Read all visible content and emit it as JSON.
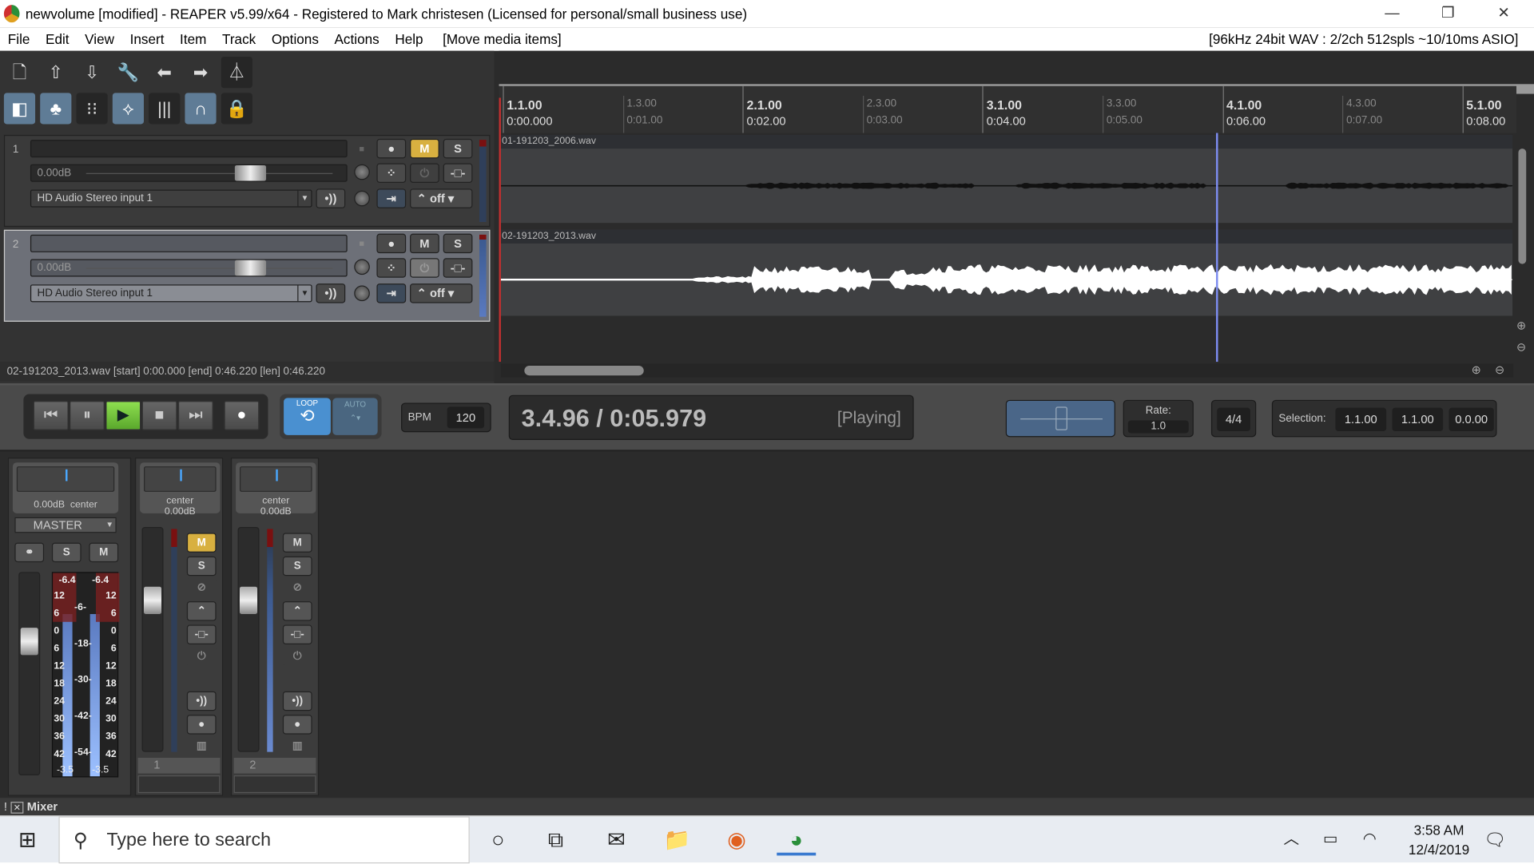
{
  "window": {
    "title": "newvolume [modified] - REAPER v5.99/x64 - Registered to Mark christesen (Licensed for personal/small business use)",
    "minimize": "—",
    "restore": "❐",
    "close": "✕"
  },
  "menu": {
    "items": [
      "File",
      "Edit",
      "View",
      "Insert",
      "Item",
      "Track",
      "Options",
      "Actions",
      "Help"
    ],
    "action": "[Move media items]",
    "audio_info": "[96kHz 24bit WAV : 2/2ch 512spls ~10/10ms ASIO]"
  },
  "tracks": [
    {
      "number": "1",
      "volume": "0.00dB",
      "input": "HD Audio Stereo input 1",
      "rec": "●",
      "mute": "M",
      "solo": "S",
      "auto": "off",
      "muted": true
    },
    {
      "number": "2",
      "volume": "0.00dB",
      "input": "HD Audio Stereo input 1",
      "rec": "●",
      "mute": "M",
      "solo": "S",
      "auto": "off",
      "muted": false
    }
  ],
  "status_line": "02-191203_2013.wav [start] 0:00.000 [end] 0:46.220 [len] 0:46.220",
  "ruler": [
    {
      "bar": "1.1.00",
      "time": "0:00.000",
      "major": true
    },
    {
      "bar": "1.3.00",
      "time": "0:01.00",
      "major": false
    },
    {
      "bar": "2.1.00",
      "time": "0:02.00",
      "major": true
    },
    {
      "bar": "2.3.00",
      "time": "0:03.00",
      "major": false
    },
    {
      "bar": "3.1.00",
      "time": "0:04.00",
      "major": true
    },
    {
      "bar": "3.3.00",
      "time": "0:05.00",
      "major": false
    },
    {
      "bar": "4.1.00",
      "time": "0:06.00",
      "major": true
    },
    {
      "bar": "4.3.00",
      "time": "0:07.00",
      "major": false
    },
    {
      "bar": "5.1.00",
      "time": "0:08.00",
      "major": true
    }
  ],
  "items": [
    "01-191203_2006.wav",
    "02-191203_2013.wav"
  ],
  "transport": {
    "loop": "LOOP",
    "auto": "AUTO",
    "bpm_label": "BPM",
    "bpm": "120",
    "position": "3.4.96 / 0:05.979",
    "state": "[Playing]",
    "rate_label": "Rate:",
    "rate": "1.0",
    "timesig": "4/4",
    "selection_label": "Selection:",
    "sel_start": "1.1.00",
    "sel_end": "1.1.00",
    "sel_len": "0.0.00"
  },
  "mixer": {
    "master": {
      "vol": "0.00dB",
      "pan": "center",
      "name": "MASTER",
      "stereo": "⚭",
      "solo": "S",
      "mute": "M",
      "peak_l": "-6.4",
      "peak_r": "-6.4",
      "scale": [
        "12",
        "6",
        "0",
        "6",
        "12",
        "18",
        "24",
        "30",
        "36",
        "42"
      ],
      "mid_scale": [
        "-6-",
        "-18-",
        "-30-",
        "-42-",
        "-54-"
      ],
      "bottom": [
        "-3.5",
        "-3.5"
      ]
    },
    "channels": [
      {
        "pan": "center",
        "vol": "0.00dB",
        "number": "1",
        "mute": "M",
        "solo": "S",
        "muted": true
      },
      {
        "pan": "center",
        "vol": "0.00dB",
        "number": "2",
        "mute": "M",
        "solo": "S",
        "muted": false
      }
    ],
    "tab": "Mixer"
  },
  "taskbar": {
    "search_placeholder": "Type here to search",
    "time": "3:58 AM",
    "date": "12/4/2019"
  },
  "colors": {
    "mute": "#d8b040",
    "play": "#6cc038",
    "cursor": "#7d8cf0",
    "waveform": "#ffffff"
  }
}
